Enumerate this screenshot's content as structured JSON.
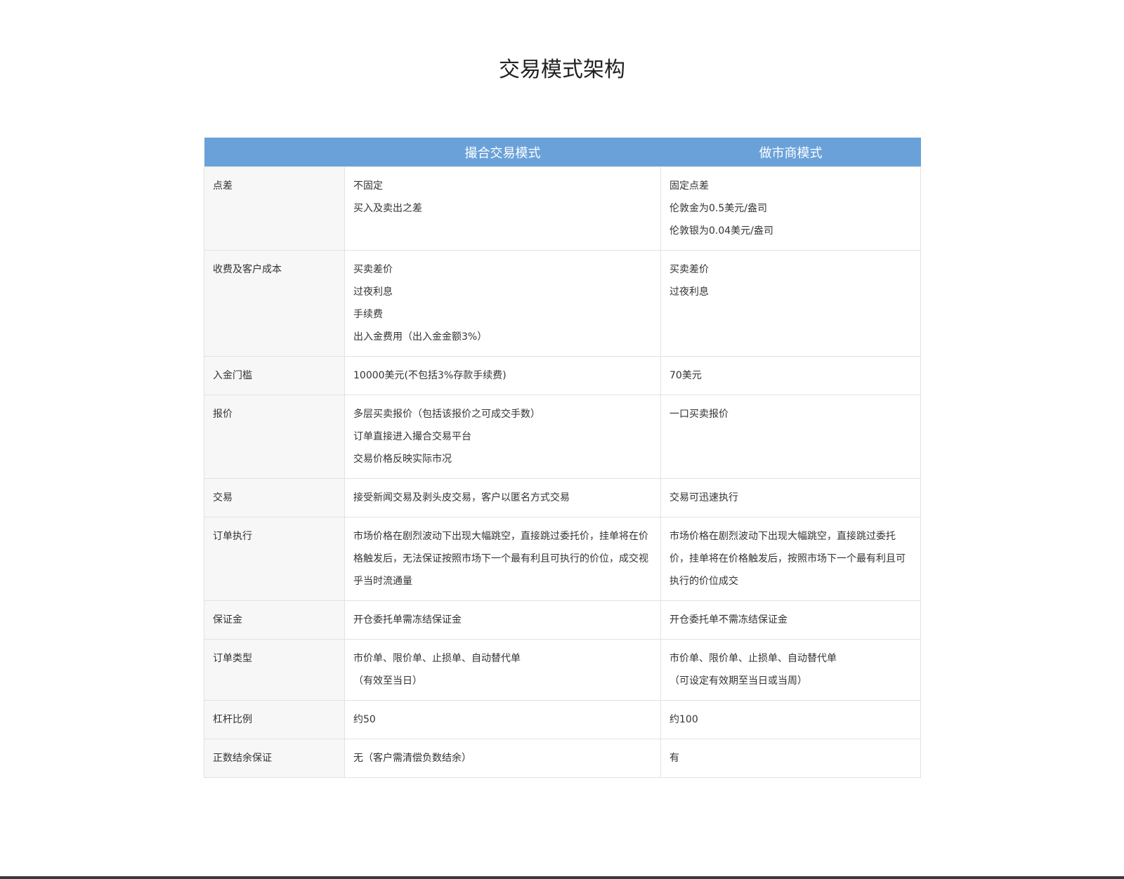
{
  "title": "交易模式架构",
  "table": {
    "headers": [
      "",
      "撮合交易模式",
      "做市商模式"
    ],
    "rows": [
      {
        "label": "点差",
        "col1": [
          "不固定",
          "买入及卖出之差"
        ],
        "col2": [
          "固定点差",
          "伦敦金为0.5美元/盎司",
          "伦敦银为0.04美元/盎司"
        ]
      },
      {
        "label": "收费及客户成本",
        "col1": [
          "买卖差价",
          "过夜利息",
          "手续费",
          "出入金费用（出入金金额3%）"
        ],
        "col2": [
          "买卖差价",
          "过夜利息"
        ]
      },
      {
        "label": "入金门槛",
        "col1": [
          "10000美元(不包括3%存款手续费)"
        ],
        "col2": [
          "70美元"
        ]
      },
      {
        "label": "报价",
        "col1": [
          "多层买卖报价（包括该报价之可成交手数）",
          "订单直接进入撮合交易平台",
          "交易价格反映实际市况"
        ],
        "col2": [
          "一口买卖报价"
        ]
      },
      {
        "label": "交易",
        "col1": [
          "接受新闻交易及剥头皮交易，客户以匿名方式交易"
        ],
        "col2": [
          "交易可迅速执行"
        ]
      },
      {
        "label": "订单执行",
        "col1": [
          "市场价格在剧烈波动下出现大幅跳空，直接跳过委托价，挂单将在价格触发后，无法保证按照市场下一个最有利且可执行的价位，成交视乎当时流通量"
        ],
        "col2": [
          "市场价格在剧烈波动下出现大幅跳空，直接跳过委托价，挂单将在价格触发后，按照市场下一个最有利且可执行的价位成交"
        ]
      },
      {
        "label": "保证金",
        "col1": [
          "开仓委托单需冻结保证金"
        ],
        "col2": [
          "开仓委托单不需冻结保证金"
        ]
      },
      {
        "label": "订单类型",
        "col1": [
          "市价单、限价单、止损单、自动替代单",
          "（有效至当日）"
        ],
        "col2": [
          "市价单、限价单、止损单、自动替代单",
          "（可设定有效期至当日或当周）"
        ]
      },
      {
        "label": "杠杆比例",
        "col1": [
          "约50"
        ],
        "col2": [
          "约100"
        ]
      },
      {
        "label": "正数结余保证",
        "col1": [
          "无（客户需清偿负数结余）"
        ],
        "col2": [
          "有"
        ]
      }
    ]
  },
  "colors": {
    "header_bg": "#6aa1d9",
    "header_text": "#ffffff",
    "label_bg": "#f7f7f7",
    "border": "#e2e2e2",
    "bottom_bar": "#3a3a3a"
  }
}
